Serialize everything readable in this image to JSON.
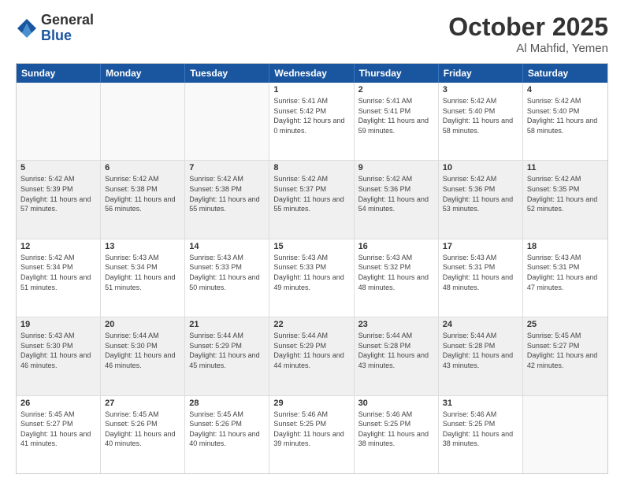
{
  "header": {
    "logo_general": "General",
    "logo_blue": "Blue",
    "month_title": "October 2025",
    "location": "Al Mahfid, Yemen"
  },
  "day_headers": [
    "Sunday",
    "Monday",
    "Tuesday",
    "Wednesday",
    "Thursday",
    "Friday",
    "Saturday"
  ],
  "weeks": [
    [
      {
        "day": "",
        "info": "",
        "empty": true
      },
      {
        "day": "",
        "info": "",
        "empty": true
      },
      {
        "day": "",
        "info": "",
        "empty": true
      },
      {
        "day": "1",
        "info": "Sunrise: 5:41 AM\nSunset: 5:42 PM\nDaylight: 12 hours\nand 0 minutes."
      },
      {
        "day": "2",
        "info": "Sunrise: 5:41 AM\nSunset: 5:41 PM\nDaylight: 11 hours\nand 59 minutes."
      },
      {
        "day": "3",
        "info": "Sunrise: 5:42 AM\nSunset: 5:40 PM\nDaylight: 11 hours\nand 58 minutes."
      },
      {
        "day": "4",
        "info": "Sunrise: 5:42 AM\nSunset: 5:40 PM\nDaylight: 11 hours\nand 58 minutes."
      }
    ],
    [
      {
        "day": "5",
        "info": "Sunrise: 5:42 AM\nSunset: 5:39 PM\nDaylight: 11 hours\nand 57 minutes."
      },
      {
        "day": "6",
        "info": "Sunrise: 5:42 AM\nSunset: 5:38 PM\nDaylight: 11 hours\nand 56 minutes."
      },
      {
        "day": "7",
        "info": "Sunrise: 5:42 AM\nSunset: 5:38 PM\nDaylight: 11 hours\nand 55 minutes."
      },
      {
        "day": "8",
        "info": "Sunrise: 5:42 AM\nSunset: 5:37 PM\nDaylight: 11 hours\nand 55 minutes."
      },
      {
        "day": "9",
        "info": "Sunrise: 5:42 AM\nSunset: 5:36 PM\nDaylight: 11 hours\nand 54 minutes."
      },
      {
        "day": "10",
        "info": "Sunrise: 5:42 AM\nSunset: 5:36 PM\nDaylight: 11 hours\nand 53 minutes."
      },
      {
        "day": "11",
        "info": "Sunrise: 5:42 AM\nSunset: 5:35 PM\nDaylight: 11 hours\nand 52 minutes."
      }
    ],
    [
      {
        "day": "12",
        "info": "Sunrise: 5:42 AM\nSunset: 5:34 PM\nDaylight: 11 hours\nand 51 minutes."
      },
      {
        "day": "13",
        "info": "Sunrise: 5:43 AM\nSunset: 5:34 PM\nDaylight: 11 hours\nand 51 minutes."
      },
      {
        "day": "14",
        "info": "Sunrise: 5:43 AM\nSunset: 5:33 PM\nDaylight: 11 hours\nand 50 minutes."
      },
      {
        "day": "15",
        "info": "Sunrise: 5:43 AM\nSunset: 5:33 PM\nDaylight: 11 hours\nand 49 minutes."
      },
      {
        "day": "16",
        "info": "Sunrise: 5:43 AM\nSunset: 5:32 PM\nDaylight: 11 hours\nand 48 minutes."
      },
      {
        "day": "17",
        "info": "Sunrise: 5:43 AM\nSunset: 5:31 PM\nDaylight: 11 hours\nand 48 minutes."
      },
      {
        "day": "18",
        "info": "Sunrise: 5:43 AM\nSunset: 5:31 PM\nDaylight: 11 hours\nand 47 minutes."
      }
    ],
    [
      {
        "day": "19",
        "info": "Sunrise: 5:43 AM\nSunset: 5:30 PM\nDaylight: 11 hours\nand 46 minutes."
      },
      {
        "day": "20",
        "info": "Sunrise: 5:44 AM\nSunset: 5:30 PM\nDaylight: 11 hours\nand 46 minutes."
      },
      {
        "day": "21",
        "info": "Sunrise: 5:44 AM\nSunset: 5:29 PM\nDaylight: 11 hours\nand 45 minutes."
      },
      {
        "day": "22",
        "info": "Sunrise: 5:44 AM\nSunset: 5:29 PM\nDaylight: 11 hours\nand 44 minutes."
      },
      {
        "day": "23",
        "info": "Sunrise: 5:44 AM\nSunset: 5:28 PM\nDaylight: 11 hours\nand 43 minutes."
      },
      {
        "day": "24",
        "info": "Sunrise: 5:44 AM\nSunset: 5:28 PM\nDaylight: 11 hours\nand 43 minutes."
      },
      {
        "day": "25",
        "info": "Sunrise: 5:45 AM\nSunset: 5:27 PM\nDaylight: 11 hours\nand 42 minutes."
      }
    ],
    [
      {
        "day": "26",
        "info": "Sunrise: 5:45 AM\nSunset: 5:27 PM\nDaylight: 11 hours\nand 41 minutes."
      },
      {
        "day": "27",
        "info": "Sunrise: 5:45 AM\nSunset: 5:26 PM\nDaylight: 11 hours\nand 40 minutes."
      },
      {
        "day": "28",
        "info": "Sunrise: 5:45 AM\nSunset: 5:26 PM\nDaylight: 11 hours\nand 40 minutes."
      },
      {
        "day": "29",
        "info": "Sunrise: 5:46 AM\nSunset: 5:25 PM\nDaylight: 11 hours\nand 39 minutes."
      },
      {
        "day": "30",
        "info": "Sunrise: 5:46 AM\nSunset: 5:25 PM\nDaylight: 11 hours\nand 38 minutes."
      },
      {
        "day": "31",
        "info": "Sunrise: 5:46 AM\nSunset: 5:25 PM\nDaylight: 11 hours\nand 38 minutes."
      },
      {
        "day": "",
        "info": "",
        "empty": true
      }
    ]
  ]
}
